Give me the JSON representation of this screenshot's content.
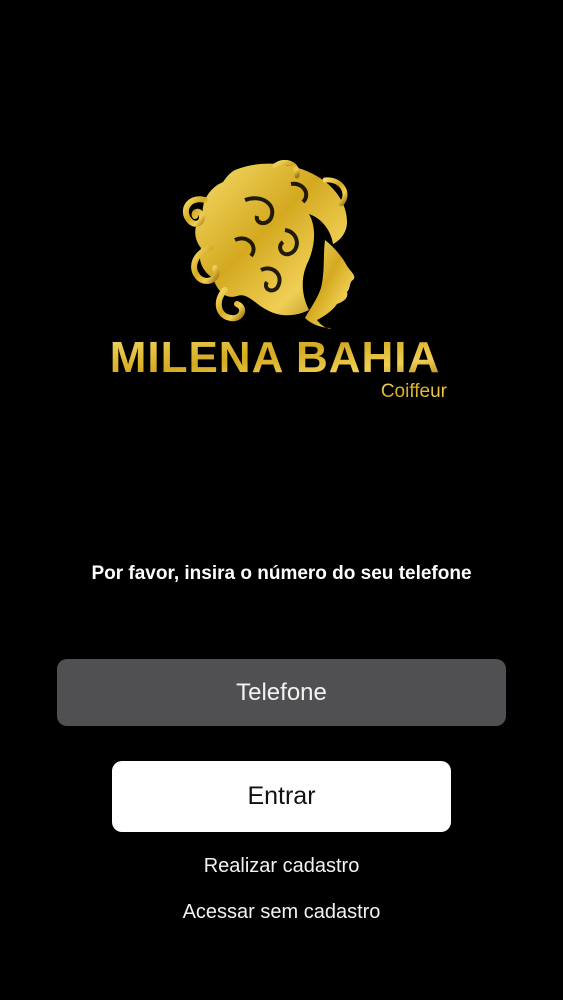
{
  "logo": {
    "brand_name": "MILENA BAHIA",
    "tagline": "Coiffeur",
    "icon": "woman-hair-silhouette-icon",
    "accent_color": "#d4a920"
  },
  "login": {
    "prompt": "Por favor, insira o número do seu telefone",
    "phone_placeholder": "Telefone",
    "phone_value": "",
    "enter_label": "Entrar",
    "register_label": "Realizar cadastro",
    "guest_label": "Acessar sem cadastro"
  }
}
